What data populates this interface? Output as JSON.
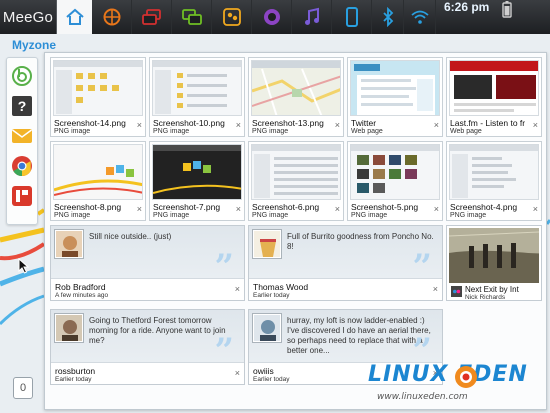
{
  "topbar": {
    "brand": "MeeGo",
    "clock": "6:26 pm",
    "zones": [
      {
        "name": "home-zone",
        "icon": "home-icon",
        "color": "#2d8ed6"
      },
      {
        "name": "web-zone",
        "icon": "globe-icon",
        "color": "#e8761a"
      },
      {
        "name": "windows-zone",
        "icon": "windows-icon",
        "color": "#d23030"
      },
      {
        "name": "status-zone",
        "icon": "status-icon",
        "color": "#6fbf24"
      },
      {
        "name": "people-zone",
        "icon": "people-icon",
        "color": "#f0a81f"
      },
      {
        "name": "applications-zone",
        "icon": "apps-icon",
        "color": "#8c44c4"
      },
      {
        "name": "music-zone",
        "icon": "music-icon",
        "color": "#7a5cd8"
      },
      {
        "name": "devices-zone",
        "icon": "device-icon",
        "color": "#29a0e0"
      },
      {
        "name": "bluetooth-zone",
        "icon": "bluetooth-icon",
        "color": "#29a0e0"
      },
      {
        "name": "network-zone",
        "icon": "wifi-icon",
        "color": "#29a0e0"
      },
      {
        "name": "battery",
        "icon": "battery-icon",
        "color": "#cfcfcf"
      }
    ]
  },
  "zone_title": "Myzone",
  "rail": {
    "items": [
      "bisigi-icon",
      "help-icon",
      "email-icon",
      "chrome-icon",
      "presentation-icon"
    ],
    "bottom_badge": "0"
  },
  "recent_files": [
    {
      "name": "Screenshot-14.png",
      "type": "PNG image",
      "thumb": "app"
    },
    {
      "name": "Screenshot-10.png",
      "type": "PNG image",
      "thumb": "app"
    },
    {
      "name": "Screenshot-13.png",
      "type": "PNG image",
      "thumb": "map"
    },
    {
      "name": "Twitter",
      "type": "Web page",
      "thumb": "twitter"
    },
    {
      "name": "Last.fm - Listen to fr",
      "type": "Web page",
      "thumb": "lastfm"
    },
    {
      "name": "Screenshot-8.png",
      "type": "PNG image",
      "thumb": "desktop"
    },
    {
      "name": "Screenshot-7.png",
      "type": "PNG image",
      "thumb": "dark"
    },
    {
      "name": "Screenshot-6.png",
      "type": "PNG image",
      "thumb": "app"
    },
    {
      "name": "Screenshot-5.png",
      "type": "PNG image",
      "thumb": "gallery"
    },
    {
      "name": "Screenshot-4.png",
      "type": "PNG image",
      "thumb": "app"
    }
  ],
  "status_updates": [
    {
      "message": "Still nice outside.. (just)",
      "author": "Rob Bradford",
      "when": "A few minutes ago",
      "avatar_color": "#c98f5a"
    },
    {
      "message": "Full of Burrito goodness from Poncho No. 8!",
      "author": "Thomas Wood",
      "when": "Earlier today",
      "avatar_color": "#e4b050"
    },
    {
      "message": "Going to Thetford Forest tomorrow morning for a ride. Anyone want to join me?",
      "author": "rossburton",
      "when": "Earlier today",
      "avatar_color": "#8a6a52"
    },
    {
      "message": "hurray, my loft is now ladder-enabled :) I've discovered I do have an aerial there, so perhaps need to replace that with a better one...",
      "author": "owiiis",
      "when": "Earlier today",
      "avatar_color": "#6f8fa8"
    }
  ],
  "photo": {
    "title": "Next Exit by Int",
    "owner": "Nick Richards"
  },
  "watermark": {
    "logo": "LINUX EDEN",
    "url": "www.linuxeden.com"
  },
  "close_glyph": "×"
}
